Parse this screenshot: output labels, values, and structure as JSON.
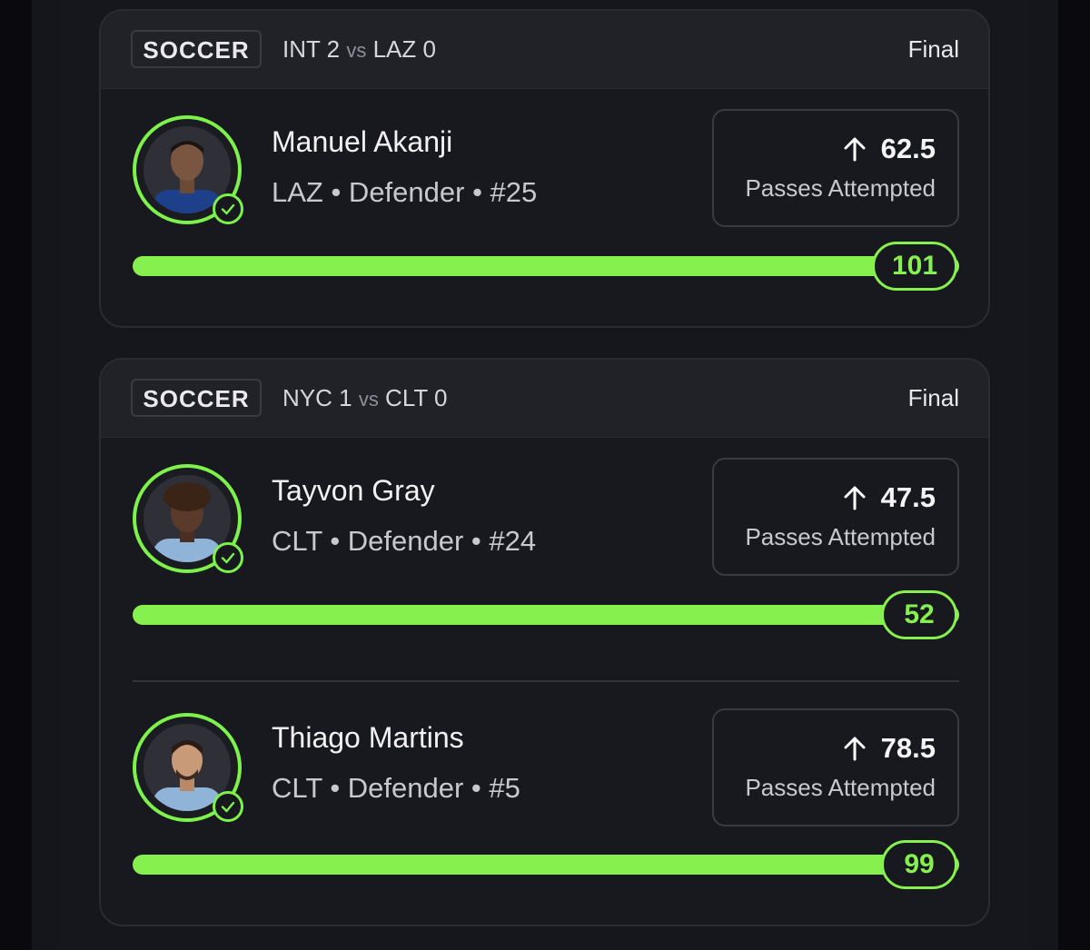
{
  "cards": [
    {
      "sport": "SOCCER",
      "matchup": {
        "home": "INT 2",
        "vs": "vs",
        "away": "LAZ 0"
      },
      "status": "Final",
      "players": [
        {
          "name": "Manuel Akanji",
          "meta": "LAZ • Defender • #25",
          "line": "62.5",
          "stat_label": "Passes Attempted",
          "result": "101",
          "progress": 1.0,
          "kit_color": "#1e3f8a",
          "direction_icon": "arrow-up-icon"
        }
      ]
    },
    {
      "sport": "SOCCER",
      "matchup": {
        "home": "NYC 1",
        "vs": "vs",
        "away": "CLT 0"
      },
      "status": "Final",
      "players": [
        {
          "name": "Tayvon Gray",
          "meta": "CLT • Defender • #24",
          "line": "47.5",
          "stat_label": "Passes Attempted",
          "result": "52",
          "progress": 1.0,
          "kit_color": "#8fb4d8",
          "direction_icon": "arrow-up-icon"
        },
        {
          "name": "Thiago Martins",
          "meta": "CLT • Defender • #5",
          "line": "78.5",
          "stat_label": "Passes Attempted",
          "result": "99",
          "progress": 1.0,
          "kit_color": "#8fb4d8",
          "direction_icon": "arrow-up-icon"
        }
      ]
    }
  ],
  "colors": {
    "accent": "#86f04e",
    "ring": "#7df24a",
    "card_bg": "#18181f",
    "header_bg": "#212128"
  }
}
